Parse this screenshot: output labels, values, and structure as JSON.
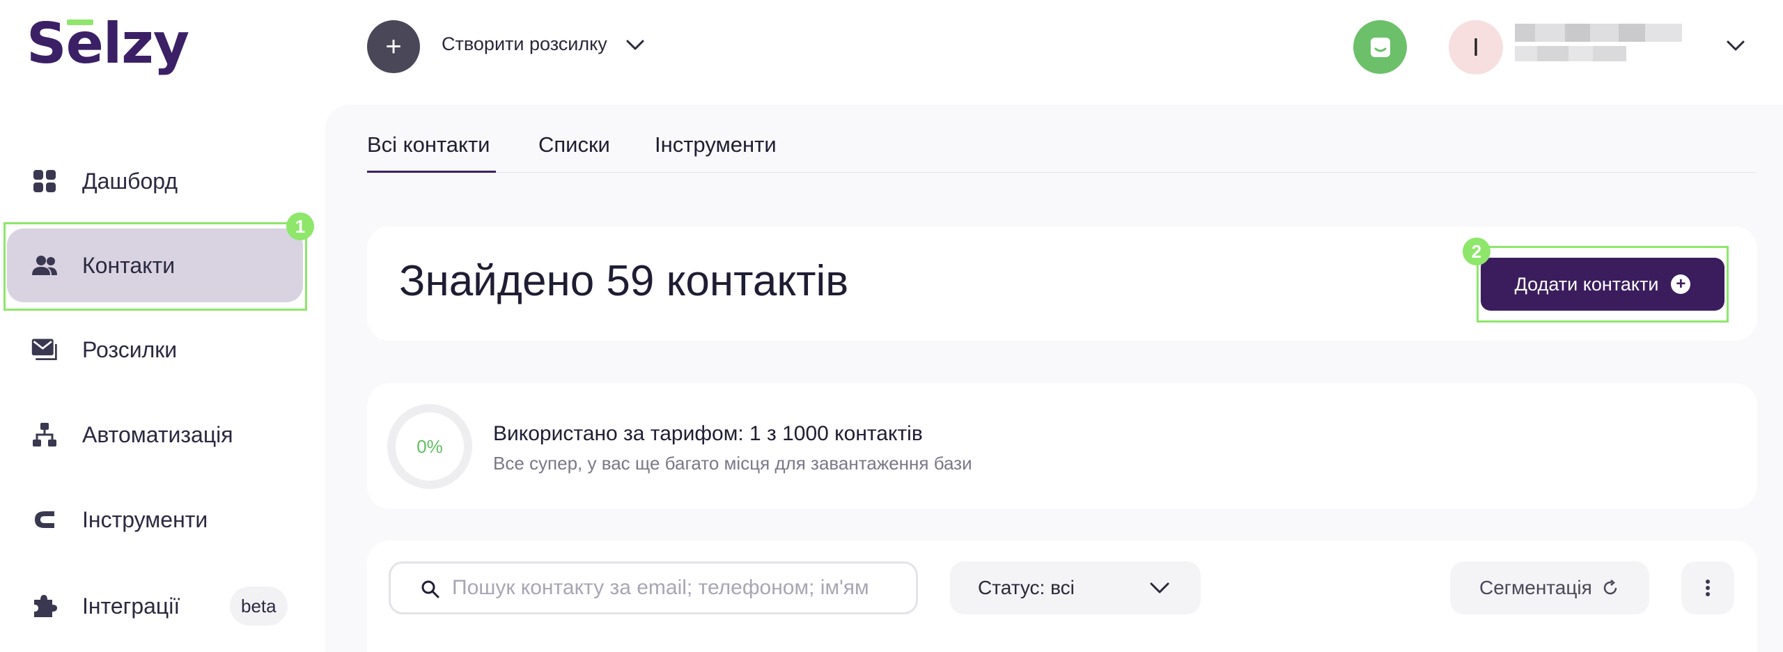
{
  "brand": {
    "logo_text": "Selzy",
    "accent": "#8ee66b",
    "primary": "#3b1d5e"
  },
  "header": {
    "create_label": "Створити розсилку",
    "avatar_initial": "I"
  },
  "sidebar": {
    "items": [
      {
        "label": "Дашборд",
        "icon": "dashboard-grid-icon"
      },
      {
        "label": "Контакти",
        "icon": "users-icon",
        "active": true,
        "highlight": "1"
      },
      {
        "label": "Розсилки",
        "icon": "mail-stack-icon"
      },
      {
        "label": "Автоматизація",
        "icon": "hierarchy-icon"
      },
      {
        "label": "Інструменти",
        "icon": "magnet-icon"
      },
      {
        "label": "Інтеграції",
        "icon": "puzzle-icon",
        "badge": "beta"
      }
    ]
  },
  "tabs": [
    {
      "label": "Всі контакти",
      "active": true
    },
    {
      "label": "Списки"
    },
    {
      "label": "Інструменти"
    }
  ],
  "summary": {
    "title": "Знайдено 59 контактів",
    "add_button": "Додати контакти",
    "add_highlight": "2"
  },
  "usage": {
    "percent_label": "0%",
    "percent": 0,
    "title": "Використано за тарифом: 1 з 1000 контактів",
    "subtitle": "Все супер, у вас ще багато місця для завантаження бази"
  },
  "filters": {
    "search_placeholder": "Пошук контакту за email; телефоном; ім'ям",
    "status_label": "Статус: всі",
    "segmentation_label": "Сегментація"
  }
}
